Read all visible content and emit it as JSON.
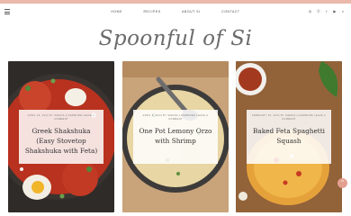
{
  "nav": {
    "items": [
      "HOME",
      "RECIPES",
      "ABOUT SI",
      "CONTACT"
    ],
    "social_icons": [
      "instagram-icon",
      "pinterest-icon",
      "facebook-icon",
      "youtube-icon",
      "search-icon"
    ]
  },
  "site": {
    "logo": "Spoonful of Si"
  },
  "posts": [
    {
      "meta": "APRIL 19, 2024 BY SIENNA LIVERMORE LEAVE A COMMENT",
      "title": "Greek Shakshuka (Easy Stovetop Shakshuka with Feta)"
    },
    {
      "meta": "APRIL 9, 2024 BY SIENNA LIVERMORE LEAVE A COMMENT",
      "title": "One Pot Lemony Orzo with Shrimp"
    },
    {
      "meta": "FEBRUARY 28, 2024 BY SIENNA LIVERMORE LEAVE A COMMENT",
      "title": "Baked Feta Spaghetti Squash"
    }
  ],
  "colors": {
    "accent": "#eab9ab",
    "scroll_button": "#e3a090"
  }
}
